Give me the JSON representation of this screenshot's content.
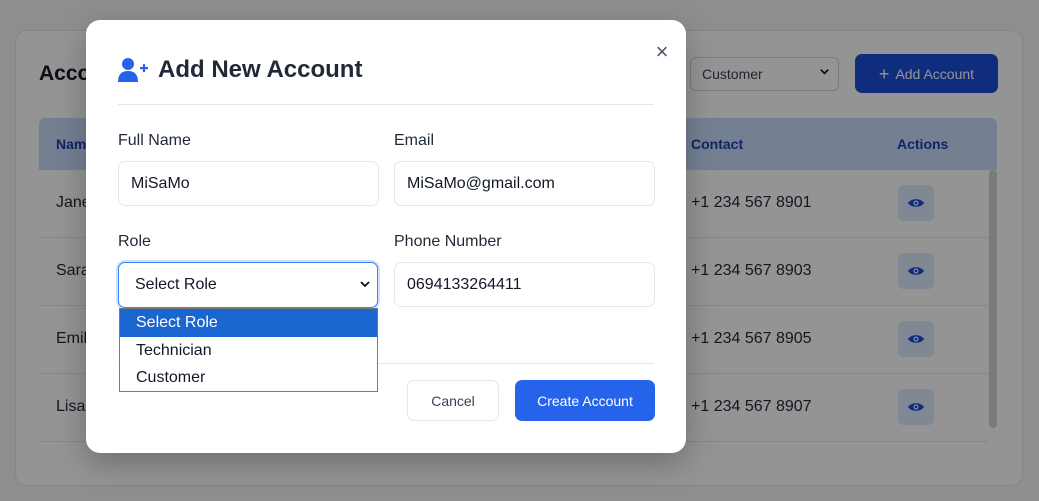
{
  "background": {
    "title": "Acco",
    "filter_value": "Customer",
    "add_button_label": "Add Account",
    "table": {
      "headers": [
        "Nam",
        "Contact",
        "Actions"
      ],
      "rows": [
        {
          "name": "Jane",
          "contact": "+1 234 567 8901"
        },
        {
          "name": "Sara",
          "contact": "+1 234 567 8903"
        },
        {
          "name": "Emil",
          "contact": "+1 234 567 8905"
        },
        {
          "name": "Lisa",
          "contact": "+1 234 567 8907"
        }
      ]
    }
  },
  "modal": {
    "title": "Add New Account",
    "close_symbol": "×",
    "fields": {
      "full_name": {
        "label": "Full Name",
        "value": "MiSaMo"
      },
      "email": {
        "label": "Email",
        "value": "MiSaMo@gmail.com"
      },
      "role": {
        "label": "Role",
        "selected": "Select Role",
        "options": [
          "Select Role",
          "Technician",
          "Customer"
        ]
      },
      "phone": {
        "label": "Phone Number",
        "value": "0694133264411"
      }
    },
    "buttons": {
      "cancel": "Cancel",
      "create": "Create Account"
    }
  },
  "colors": {
    "primary": "#2563eb",
    "primary_dark": "#1d4ed8",
    "dropdown_highlight": "#1a66d1",
    "table_header": "#c9ddfb"
  },
  "icons": {
    "modal_header": "user-plus-icon",
    "close": "close-icon",
    "select": "chevron-down-icon",
    "row_action": "eye-icon",
    "add": "plus-icon"
  }
}
